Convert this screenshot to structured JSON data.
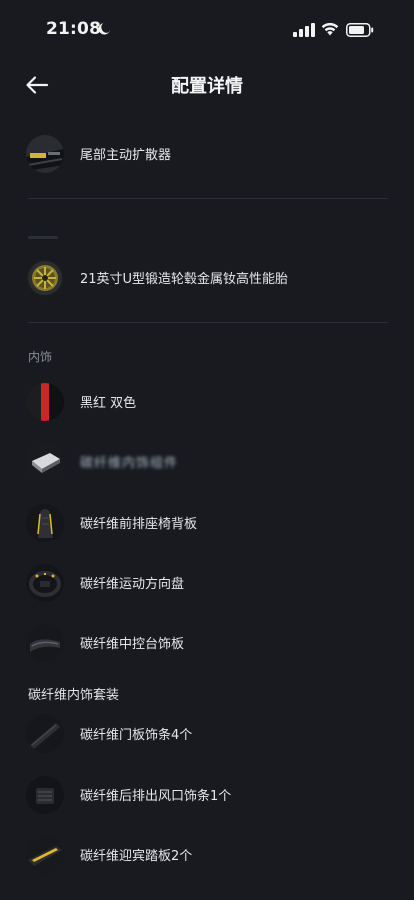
{
  "status_bar": {
    "time": "21:08"
  },
  "nav": {
    "title": "配置详情"
  },
  "sections": {
    "interior_title": "内饰",
    "carbon_kit_title": "碳纤维内饰套装"
  },
  "items": [
    {
      "label": "尾部主动扩散器",
      "icon": "rear-diffuser-icon"
    },
    {
      "label": "21英寸U型锻造轮毂金属钕高性能胎",
      "icon": "wheel-icon"
    },
    {
      "label": "黑红 双色",
      "icon": "color-swatch-icon"
    },
    {
      "label": "碳纤维内饰组件",
      "icon": "carbon-part-icon"
    },
    {
      "label": "碳纤维前排座椅背板",
      "icon": "seat-back-icon"
    },
    {
      "label": "碳纤维运动方向盘",
      "icon": "steering-wheel-icon"
    },
    {
      "label": "碳纤维中控台饰板",
      "icon": "center-console-icon"
    },
    {
      "label": "碳纤维门板饰条4个",
      "icon": "door-trim-icon"
    },
    {
      "label": "碳纤维后排出风口饰条1个",
      "icon": "air-vent-icon"
    },
    {
      "label": "碳纤维迎宾踏板2个",
      "icon": "sill-plate-icon"
    }
  ],
  "colors": {
    "background": "#181a20",
    "accent_red": "#c8282a",
    "accent_yellow": "#e1b829"
  }
}
